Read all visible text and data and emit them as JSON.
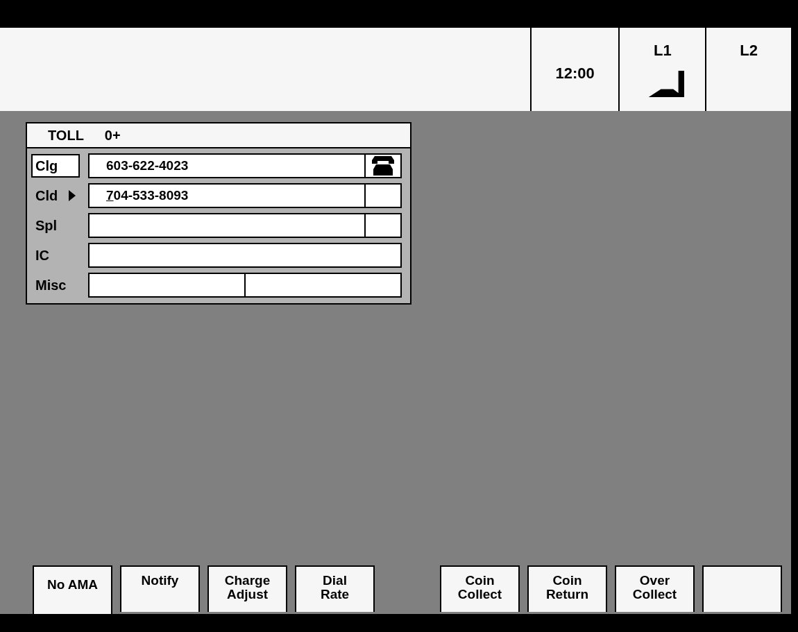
{
  "header": {
    "clock": "12:00",
    "lines": [
      {
        "label": "L1",
        "busy": true
      },
      {
        "label": "L2",
        "busy": false
      }
    ]
  },
  "call_panel": {
    "title": "TOLL",
    "call_type": "0+",
    "rows": [
      {
        "label": "Clg",
        "selected": true,
        "current": false,
        "value": "603-622-4023",
        "cursor": false,
        "kind": "side",
        "phone": true
      },
      {
        "label": "Cld",
        "selected": false,
        "current": true,
        "value": "704-533-8093",
        "cursor": true,
        "kind": "side",
        "phone": false
      },
      {
        "label": "Spl",
        "selected": false,
        "current": false,
        "kind": "side",
        "phone": false
      },
      {
        "label": "IC",
        "selected": false,
        "current": false,
        "kind": "wide"
      },
      {
        "label": "Misc",
        "selected": false,
        "current": false,
        "kind": "split"
      }
    ]
  },
  "softkeys_left": [
    {
      "label": "No AMA",
      "selected": true
    },
    {
      "label": "Notify",
      "selected": false
    },
    {
      "label": "Charge\nAdjust",
      "selected": false
    },
    {
      "label": "Dial\nRate",
      "selected": false
    }
  ],
  "softkeys_right": [
    {
      "label": "Coin\nCollect",
      "selected": false
    },
    {
      "label": "Coin\nReturn",
      "selected": false
    },
    {
      "label": "Over\nCollect",
      "selected": false
    },
    {
      "selected": false
    }
  ]
}
